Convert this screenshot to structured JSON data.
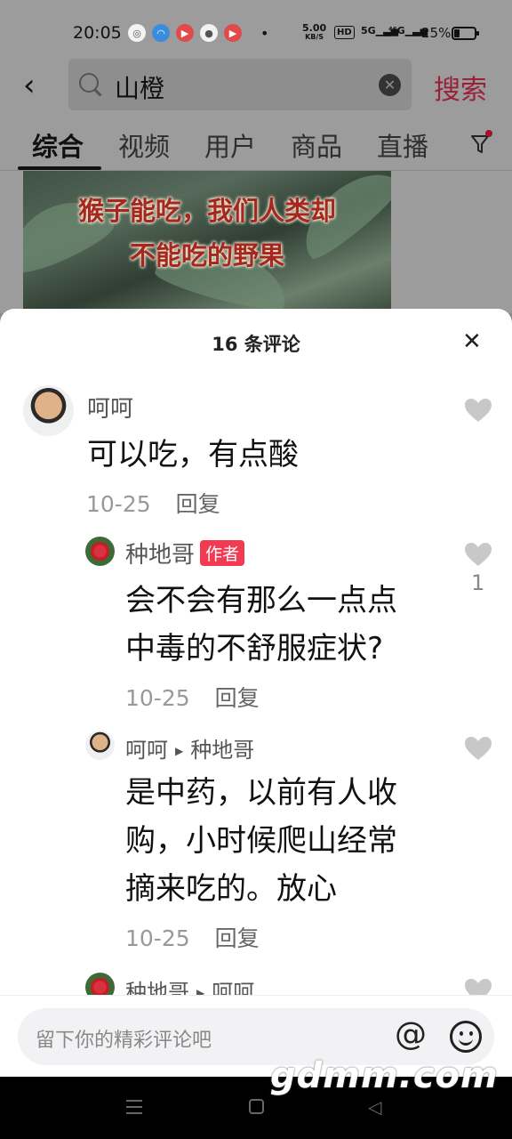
{
  "status_bar": {
    "time": "20:05",
    "speed_value": "5.00",
    "speed_unit": "KB/S",
    "hd": "HD",
    "net1": "5G",
    "net2": "⁴⁶G",
    "battery": "25%"
  },
  "search": {
    "query": "山橙",
    "submit_label": "搜索"
  },
  "tabs": [
    "综合",
    "视频",
    "用户",
    "商品",
    "直播"
  ],
  "video": {
    "title_line1": "猴子能吃，我们人类却",
    "title_line2": "不能吃的野果"
  },
  "comments_panel": {
    "title": "16 条评论",
    "comments": [
      {
        "user": "呵呵",
        "text": "可以吃，有点酸",
        "date": "10-25",
        "reply_label": "回复",
        "likes": ""
      },
      {
        "user": "种地哥",
        "badge": "作者",
        "text_line1": "会不会有那么一点点",
        "text_line2": "中毒的不舒服症状?",
        "date": "10-25",
        "reply_label": "回复",
        "likes": "1"
      },
      {
        "user": "呵呵",
        "reply_to": "种地哥",
        "text_line1": "是中药，以前有人收",
        "text_line2": "购，小时候爬山经常",
        "text_line3": "摘来吃的。放心",
        "date": "10-25",
        "reply_label": "回复"
      },
      {
        "user": "种地哥",
        "reply_to": "呵呵"
      }
    ]
  },
  "input": {
    "placeholder": "留下你的精彩评论吧",
    "at_symbol": "@"
  },
  "watermark": "gdmm.com",
  "colors": {
    "accent": "#f23a52",
    "search_button": "#9a2038",
    "overlay": "#9c9c9c"
  }
}
